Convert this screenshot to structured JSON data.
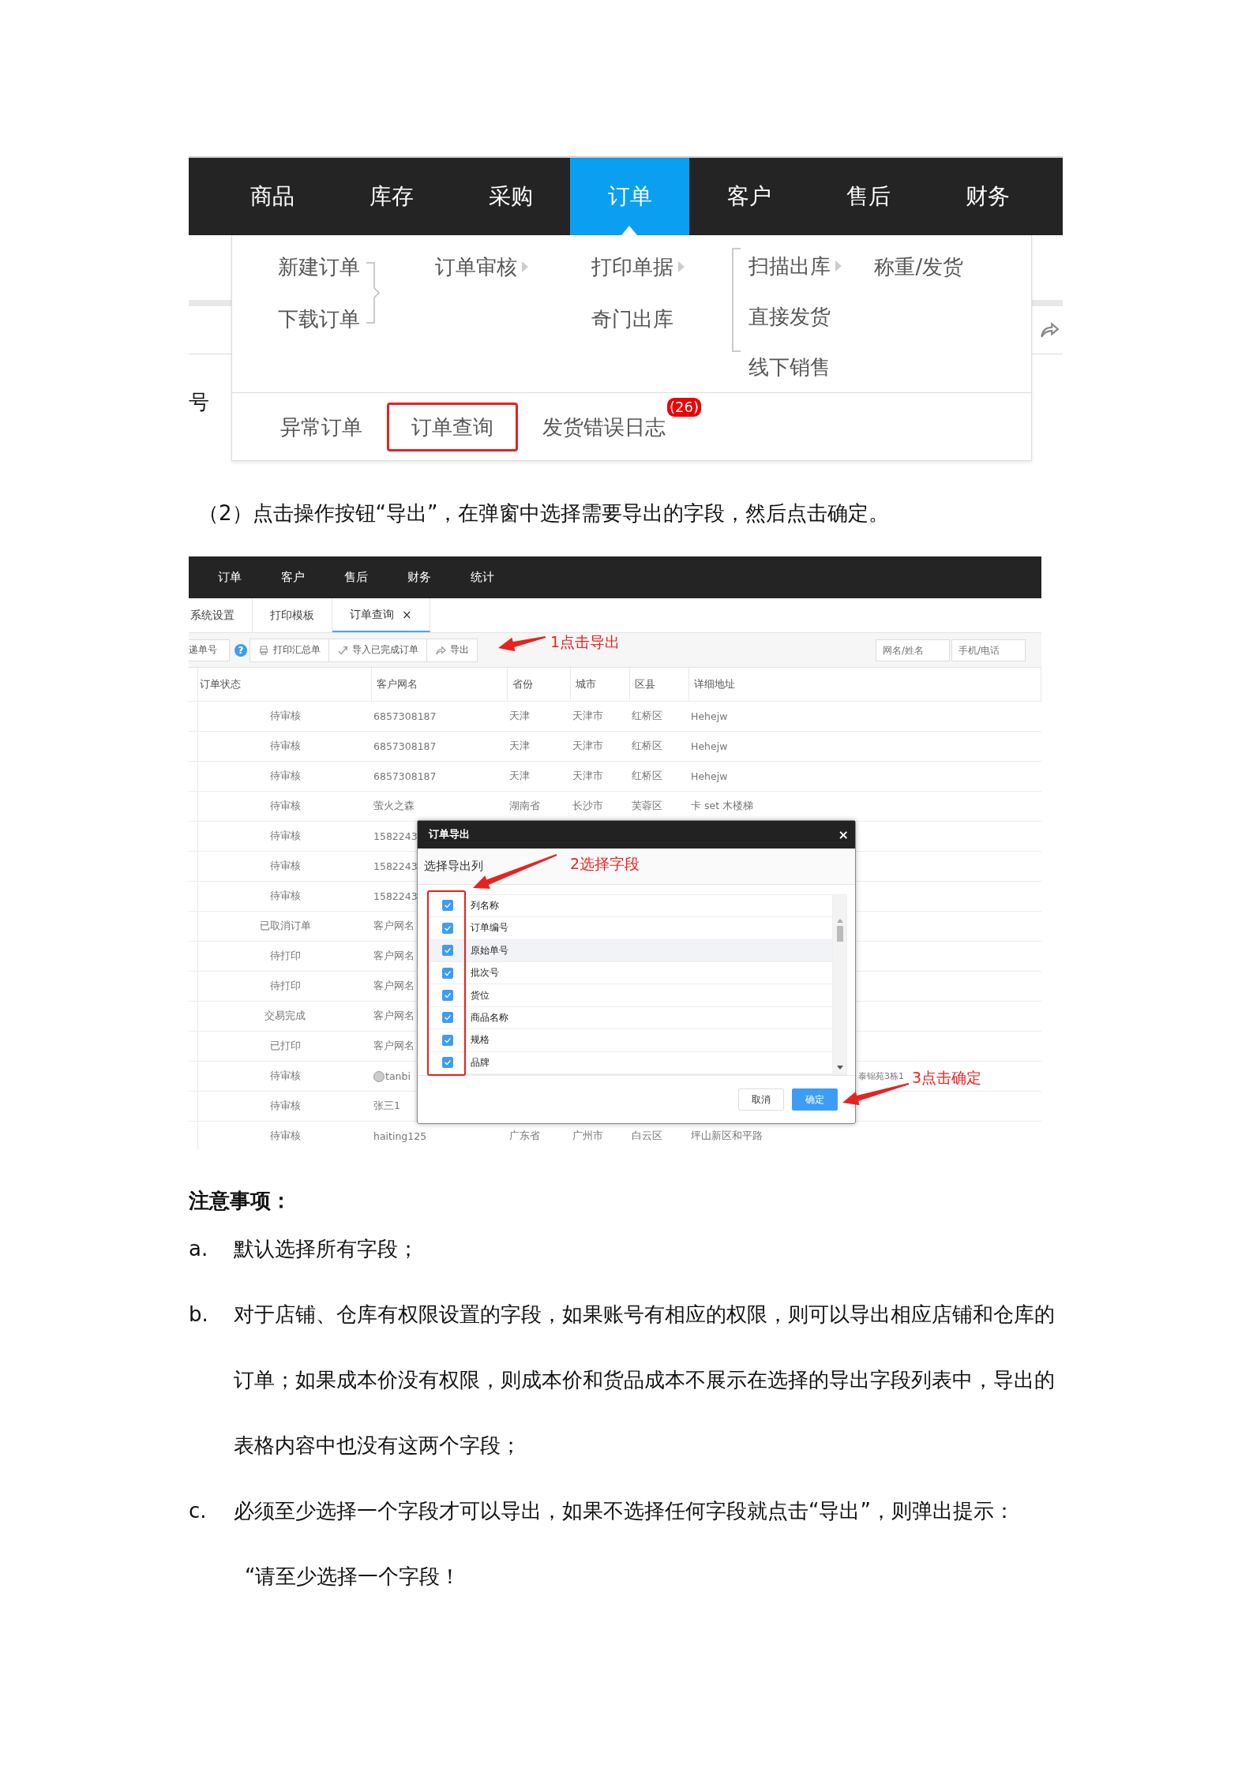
{
  "menu_screenshot": {
    "nav": [
      {
        "label": "商品",
        "selected": false
      },
      {
        "label": "库存",
        "selected": false
      },
      {
        "label": "采购",
        "selected": false
      },
      {
        "label": "订单",
        "selected": true
      },
      {
        "label": "客户",
        "selected": false
      },
      {
        "label": "售后",
        "selected": false
      },
      {
        "label": "财务",
        "selected": false
      }
    ],
    "background_label": "号",
    "menu": {
      "columns": [
        {
          "items": [
            {
              "label": "新建订单",
              "submenu": false
            },
            {
              "label": "下载订单",
              "submenu": false
            }
          ]
        },
        {
          "items": [
            {
              "label": "订单审核",
              "submenu": true
            }
          ]
        },
        {
          "items": [
            {
              "label": "打印单据",
              "submenu": true
            },
            {
              "label": "奇门出库",
              "submenu": false
            }
          ]
        },
        {
          "items": [
            {
              "label": "扫描出库",
              "submenu": true
            },
            {
              "label": "直接发货",
              "submenu": false
            },
            {
              "label": "线下销售",
              "submenu": false
            }
          ]
        },
        {
          "items": [
            {
              "label": "称重/发货",
              "submenu": false
            }
          ]
        }
      ],
      "bottom": [
        {
          "label": "异常订单",
          "highlighted": false
        },
        {
          "label": "订单查询",
          "highlighted": true
        },
        {
          "label": "发货错误日志",
          "highlighted": false,
          "badge": "(26)"
        }
      ]
    }
  },
  "step_text": "（2）点击操作按钮“导出”，在弹窗中选择需要导出的字段，然后点击确定。",
  "app_screenshot": {
    "nav": [
      {
        "label": "订单"
      },
      {
        "label": "客户"
      },
      {
        "label": "售后"
      },
      {
        "label": "财务"
      },
      {
        "label": "统计"
      }
    ],
    "tabs": [
      {
        "label": "系统设置",
        "selected": false
      },
      {
        "label": "打印模板",
        "selected": false
      },
      {
        "label": "订单查询",
        "selected": true,
        "close": "×"
      }
    ],
    "toolbar": {
      "search_label": "递单号",
      "help": "?",
      "buttons": [
        {
          "label": "打印汇总单"
        },
        {
          "label": "导入已完成订单"
        },
        {
          "label": "导出"
        }
      ],
      "filters": [
        {
          "placeholder": "网名/姓名"
        },
        {
          "placeholder": "手机/电话"
        }
      ]
    },
    "table": {
      "columns": [
        "订单状态",
        "客户网名",
        "省份",
        "城市",
        "区县",
        "详细地址"
      ],
      "rows": [
        {
          "status": "待审核",
          "name": "6857308187",
          "province": "天津",
          "city": "天津市",
          "district": "红桥区",
          "address": "Hehejw"
        },
        {
          "status": "待审核",
          "name": "6857308187",
          "province": "天津",
          "city": "天津市",
          "district": "红桥区",
          "address": "Hehejw"
        },
        {
          "status": "待审核",
          "name": "6857308187",
          "province": "天津",
          "city": "天津市",
          "district": "红桥区",
          "address": "Hehejw"
        },
        {
          "status": "待审核",
          "name": "萤火之森",
          "province": "湖南省",
          "city": "长沙市",
          "district": "芙蓉区",
          "address": "卡 set 木楼梯"
        },
        {
          "status": "待审核",
          "name": "1582243"
        },
        {
          "status": "待审核",
          "name": "1582243"
        },
        {
          "status": "待审核",
          "name": "1582243"
        },
        {
          "status": "已取消订单",
          "name": "客户网名"
        },
        {
          "status": "待打印",
          "name": "客户网名"
        },
        {
          "status": "待打印",
          "name": "客户网名"
        },
        {
          "status": "交易完成",
          "name": "客户网名"
        },
        {
          "status": "已打印",
          "name": "客户网名"
        },
        {
          "status": "待审核",
          "name": "tanbi",
          "avatar": true,
          "address_tail": "泰锦苑3栋1"
        },
        {
          "status": "待审核",
          "name": "张三1"
        },
        {
          "status": "待审核",
          "name": "haiting125",
          "province": "广东省",
          "city": "广州市",
          "district": "白云区",
          "address": "坪山新区和平路"
        }
      ]
    },
    "dialog": {
      "title": "订单导出",
      "close": "×",
      "subtitle": "选择导出列",
      "fields": [
        {
          "label": "列名称",
          "checked": true,
          "highlighted": false
        },
        {
          "label": "订单编号",
          "checked": true,
          "highlighted": false
        },
        {
          "label": "原始单号",
          "checked": true,
          "highlighted": true
        },
        {
          "label": "批次号",
          "checked": true,
          "highlighted": false
        },
        {
          "label": "货位",
          "checked": true,
          "highlighted": false
        },
        {
          "label": "商品名称",
          "checked": true,
          "highlighted": false
        },
        {
          "label": "规格",
          "checked": true,
          "highlighted": false
        },
        {
          "label": "品牌",
          "checked": true,
          "highlighted": false
        }
      ],
      "buttons": [
        {
          "label": "取消",
          "primary": false
        },
        {
          "label": "确定",
          "primary": true
        }
      ]
    },
    "annotations": [
      {
        "text": "1点击导出"
      },
      {
        "text": "2选择字段"
      },
      {
        "text": "3点击确定"
      }
    ]
  },
  "notes_title": "注意事项：",
  "notes": [
    {
      "marker": "a.",
      "text": "默认选择所有字段；"
    },
    {
      "marker": "b.",
      "text": "对于店铺、仓库有权限设置的字段，如果账号有相应的权限，则可以导出相应店铺和仓库的订单；如果成本价没有权限，则成本价和货品成本不展示在选择的导出字段列表中，导出的表格内容中也没有这两个字段；"
    },
    {
      "marker": "c.",
      "text": "必须至少选择一个字段才可以导出，如果不选择任何字段就点击“导出”，则弹出提示：",
      "quote": "“请至少选择一个字段！"
    }
  ]
}
